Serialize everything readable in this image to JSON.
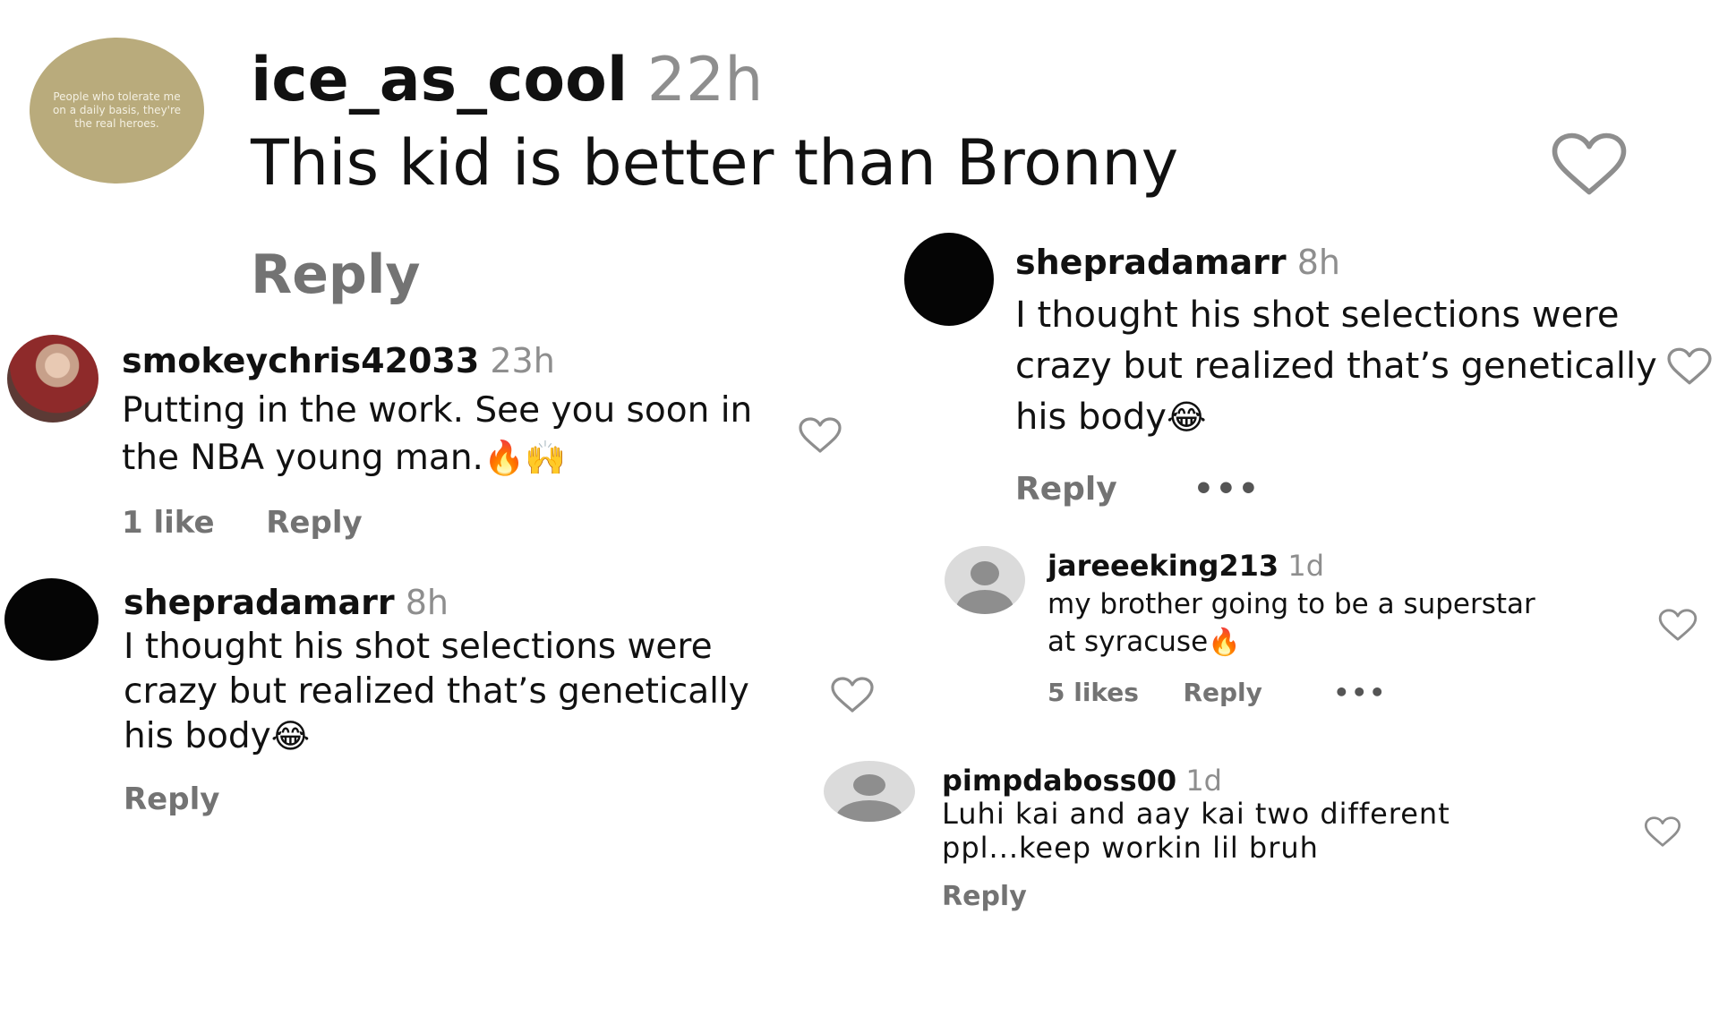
{
  "main_comment": {
    "avatar_text": "People who tolerate me on a daily basis, they're the real heroes.",
    "username": "ice_as_cool",
    "time": "22h",
    "text": "This kid is better than Bronny",
    "reply_label": "Reply"
  },
  "left_comments": [
    {
      "username": "smokeychris42033",
      "time": "23h",
      "text_line1": "Putting in the work. See you soon in",
      "text_line2": "the NBA young man.",
      "emoji": "🔥🙌",
      "likes": "1 like",
      "reply_label": "Reply"
    },
    {
      "username": "shepradamarr",
      "time": "8h",
      "text_line1": "I thought his shot selections were",
      "text_line2": "crazy but realized that’s genetically",
      "text_line3": "his body",
      "emoji": "😂",
      "reply_label": "Reply"
    }
  ],
  "right_comments": [
    {
      "username": "shepradamarr",
      "time": "8h",
      "text_line1": "I thought his shot selections were",
      "text_line2": "crazy but realized that’s genetically",
      "text_line3": "his body",
      "emoji": "😂",
      "reply_label": "Reply",
      "more": "•••"
    },
    {
      "username": "jareeeking213",
      "time": "1d",
      "text_line1": "my brother going to be a superstar",
      "text_line2": "at syracuse",
      "emoji": "🔥",
      "likes": "5 likes",
      "reply_label": "Reply",
      "more": "•••"
    },
    {
      "username": "pimpdaboss00",
      "time": "1d",
      "text_line1": "Luhi kai and aay kai two different",
      "text_line2": "ppl...keep workin lil bruh",
      "reply_label": "Reply"
    }
  ],
  "colors": {
    "username": "#111111",
    "meta": "#737373",
    "heart": "#8e8e8e"
  },
  "icons": [
    "heart-outline-icon",
    "more-dots-icon",
    "default-avatar-icon"
  ]
}
